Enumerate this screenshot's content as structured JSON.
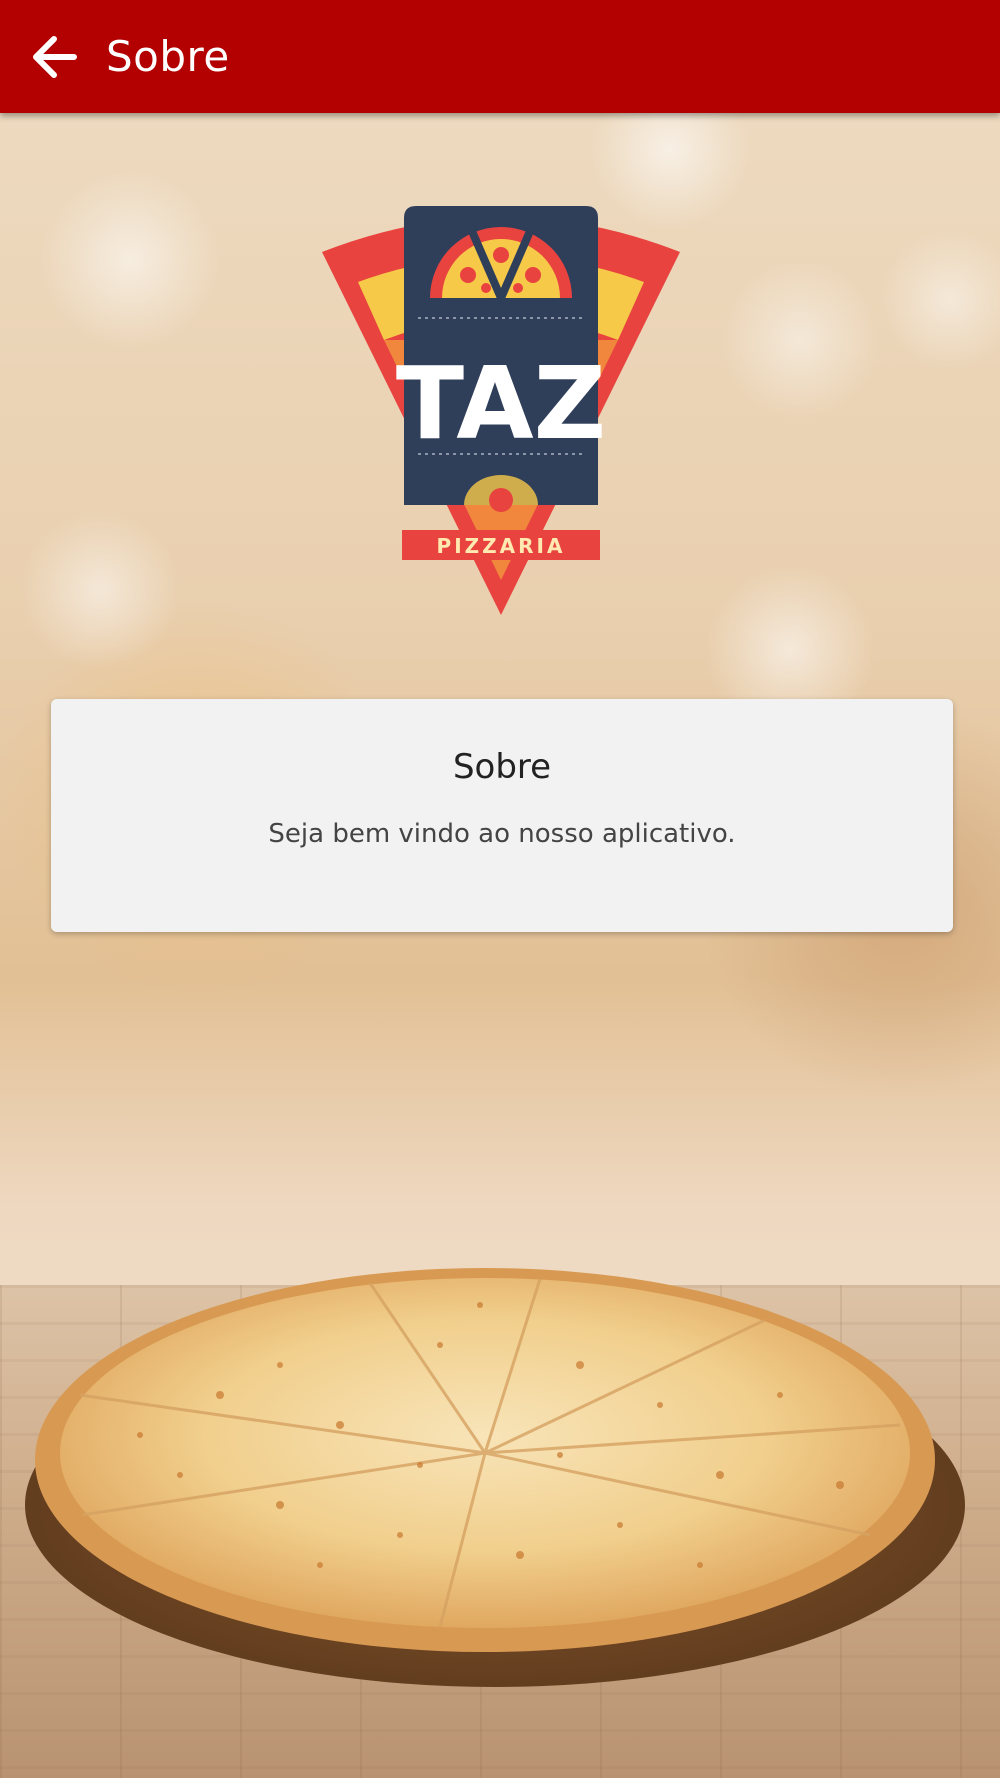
{
  "header": {
    "title": "Sobre",
    "back_icon": "arrow-left-icon",
    "background_color": "#b30000"
  },
  "logo": {
    "brand_name": "TAZ",
    "subtitle": "PIZZARIA"
  },
  "card": {
    "title": "Sobre",
    "text": "Seja bem vindo ao nosso aplicativo."
  }
}
